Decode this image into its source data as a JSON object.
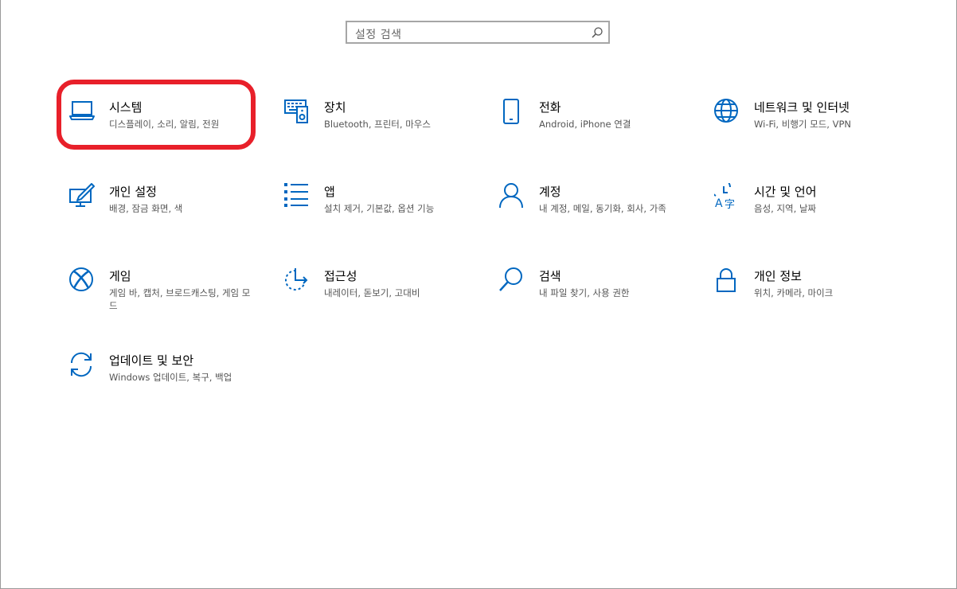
{
  "search": {
    "placeholder": "설정 검색",
    "icon": "search-icon"
  },
  "accent_color": "#0067c0",
  "highlight_color": "#e8202a",
  "tiles": [
    {
      "title": "시스템",
      "desc": "디스플레이, 소리, 알림, 전원",
      "icon": "laptop-icon"
    },
    {
      "title": "장치",
      "desc": "Bluetooth, 프린터, 마우스",
      "icon": "devices-icon"
    },
    {
      "title": "전화",
      "desc": "Android, iPhone 연결",
      "icon": "phone-icon"
    },
    {
      "title": "네트워크 및 인터넷",
      "desc": "Wi-Fi, 비행기 모드, VPN",
      "icon": "globe-icon"
    },
    {
      "title": "개인 설정",
      "desc": "배경, 잠금 화면, 색",
      "icon": "personalization-icon"
    },
    {
      "title": "앱",
      "desc": "설치 제거, 기본값, 옵션 기능",
      "icon": "apps-list-icon"
    },
    {
      "title": "계정",
      "desc": "내 계정, 메일, 동기화, 회사, 가족",
      "icon": "person-icon"
    },
    {
      "title": "시간 및 언어",
      "desc": "음성, 지역, 날짜",
      "icon": "time-language-icon"
    },
    {
      "title": "게임",
      "desc": "게임 바, 캡처, 브로드캐스팅, 게임 모드",
      "icon": "xbox-icon"
    },
    {
      "title": "접근성",
      "desc": "내레이터, 돋보기, 고대비",
      "icon": "ease-of-access-icon"
    },
    {
      "title": "검색",
      "desc": "내 파일 찾기, 사용 권한",
      "icon": "magnifier-icon"
    },
    {
      "title": "개인 정보",
      "desc": "위치, 카메라, 마이크",
      "icon": "lock-icon"
    },
    {
      "title": "업데이트 및 보안",
      "desc": "Windows 업데이트, 복구, 백업",
      "icon": "update-icon"
    }
  ]
}
